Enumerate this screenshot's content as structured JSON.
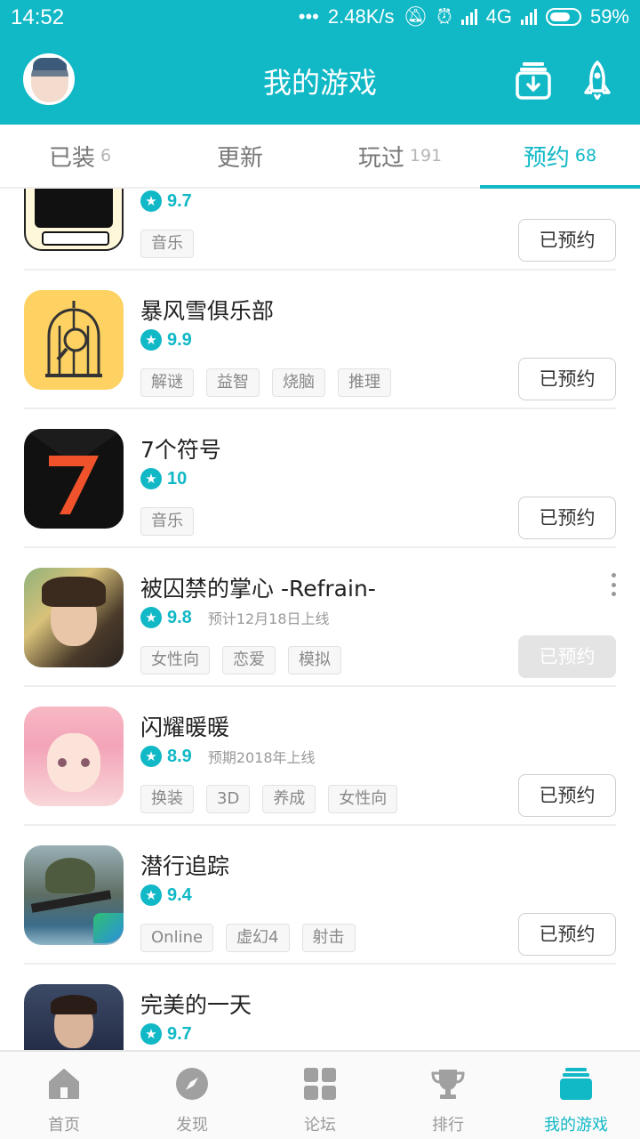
{
  "status_bar": {
    "time": "14:52",
    "net_speed": "2.48K/s",
    "network": "4G",
    "battery": "59%"
  },
  "header": {
    "title": "我的游戏",
    "accent_color": "#11b8c6",
    "icons": [
      "download-box-icon",
      "rocket-icon"
    ]
  },
  "tabs": [
    {
      "label": "已装",
      "count": "6"
    },
    {
      "label": "更新",
      "count": ""
    },
    {
      "label": "玩过",
      "count": "191"
    },
    {
      "label": "预约",
      "count": "68",
      "active": true
    }
  ],
  "games": [
    {
      "name": "",
      "score": "9.7",
      "release": "",
      "tags": [
        "音乐"
      ],
      "button": "已预约"
    },
    {
      "name": "暴风雪俱乐部",
      "score": "9.9",
      "release": "",
      "tags": [
        "解谜",
        "益智",
        "烧脑",
        "推理"
      ],
      "button": "已预约"
    },
    {
      "name": "7个符号",
      "score": "10",
      "release": "",
      "tags": [
        "音乐"
      ],
      "button": "已预约"
    },
    {
      "name": "被囚禁的掌心 -Refrain-",
      "score": "9.8",
      "release": "预计12月18日上线",
      "tags": [
        "女性向",
        "恋爱",
        "模拟"
      ],
      "button": "已预约"
    },
    {
      "name": "闪耀暖暖",
      "score": "8.9",
      "release": "预期2018年上线",
      "tags": [
        "换装",
        "3D",
        "养成",
        "女性向"
      ],
      "button": "已预约"
    },
    {
      "name": "潜行追踪",
      "score": "9.4",
      "release": "",
      "tags": [
        "Online",
        "虚幻4",
        "射击"
      ],
      "button": "已预约"
    },
    {
      "name": "完美的一天",
      "score": "9.7",
      "release": "",
      "tags": [],
      "button": ""
    }
  ],
  "bottom_nav": [
    {
      "label": "首页",
      "icon": "home-icon"
    },
    {
      "label": "发现",
      "icon": "compass-icon"
    },
    {
      "label": "论坛",
      "icon": "grid-icon"
    },
    {
      "label": "排行",
      "icon": "trophy-icon"
    },
    {
      "label": "我的游戏",
      "icon": "game-stack-icon",
      "active": true
    }
  ]
}
